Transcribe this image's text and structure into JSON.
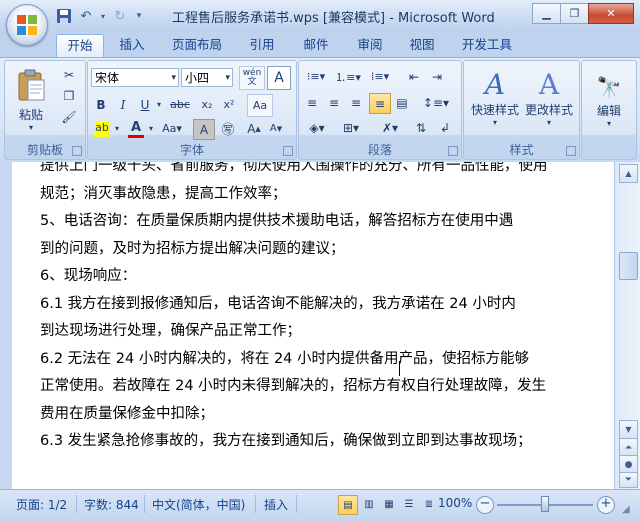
{
  "window": {
    "title": "工程售后服务承诺书.wps [兼容模式] - Microsoft Word"
  },
  "tabs": [
    {
      "label": "开始",
      "active": true
    },
    {
      "label": "插入",
      "active": false
    },
    {
      "label": "页面布局",
      "active": false
    },
    {
      "label": "引用",
      "active": false
    },
    {
      "label": "邮件",
      "active": false
    },
    {
      "label": "审阅",
      "active": false
    },
    {
      "label": "视图",
      "active": false
    },
    {
      "label": "开发工具",
      "active": false
    }
  ],
  "ribbon": {
    "clipboard": {
      "label": "剪贴板",
      "paste": "粘贴"
    },
    "font": {
      "label": "字体",
      "font_name": "宋体",
      "font_size": "小四",
      "wen": "wén\n文",
      "A": "A"
    },
    "paragraph": {
      "label": "段落"
    },
    "styles": {
      "label": "样式",
      "quick_styles": "快速样式",
      "change_styles": "更改样式"
    },
    "editing": {
      "label": "编辑"
    }
  },
  "document": {
    "lines": [
      "  提供上门一级干头、省前服务，彻庆使用人围操作的充分、所有一品性能，使用",
      "规范；消灭事故隐患，提高工作效率；",
      "    5、电话咨询：在质量保质期内提供技术援助电话，解答招标方在使用中遇",
      "到的问题，及时为招标方提出解决问题的建议；",
      "    6、现场响应：",
      "    6.1 我方在接到报修通知后，电话咨询不能解决的，我方承诺在 24 小时内",
      "到达现场进行处理，确保产品正常工作；",
      "    6.2 无法在 24 小时内解决的，将在 24 小时内提供备用产品，使招标方能够",
      "正常使用。若故障在 24 小时内未得到解决的，招标方有权自行处理故障，发生",
      "费用在质量保修金中扣除；",
      "    6.3 发生紧急抢修事故的，我方在接到通知后，确保做到立即到达事故现场；"
    ]
  },
  "statusbar": {
    "page": "页面: 1/2",
    "words": "字数: 844",
    "language": "中文(简体，中国)",
    "mode": "插入",
    "zoom": "100%",
    "zoom_value": 100
  },
  "colors": {
    "accent": "#15428b",
    "ribbon": "#dbe7f7",
    "highlight": "#ffff00",
    "font_color": "#e00000"
  }
}
